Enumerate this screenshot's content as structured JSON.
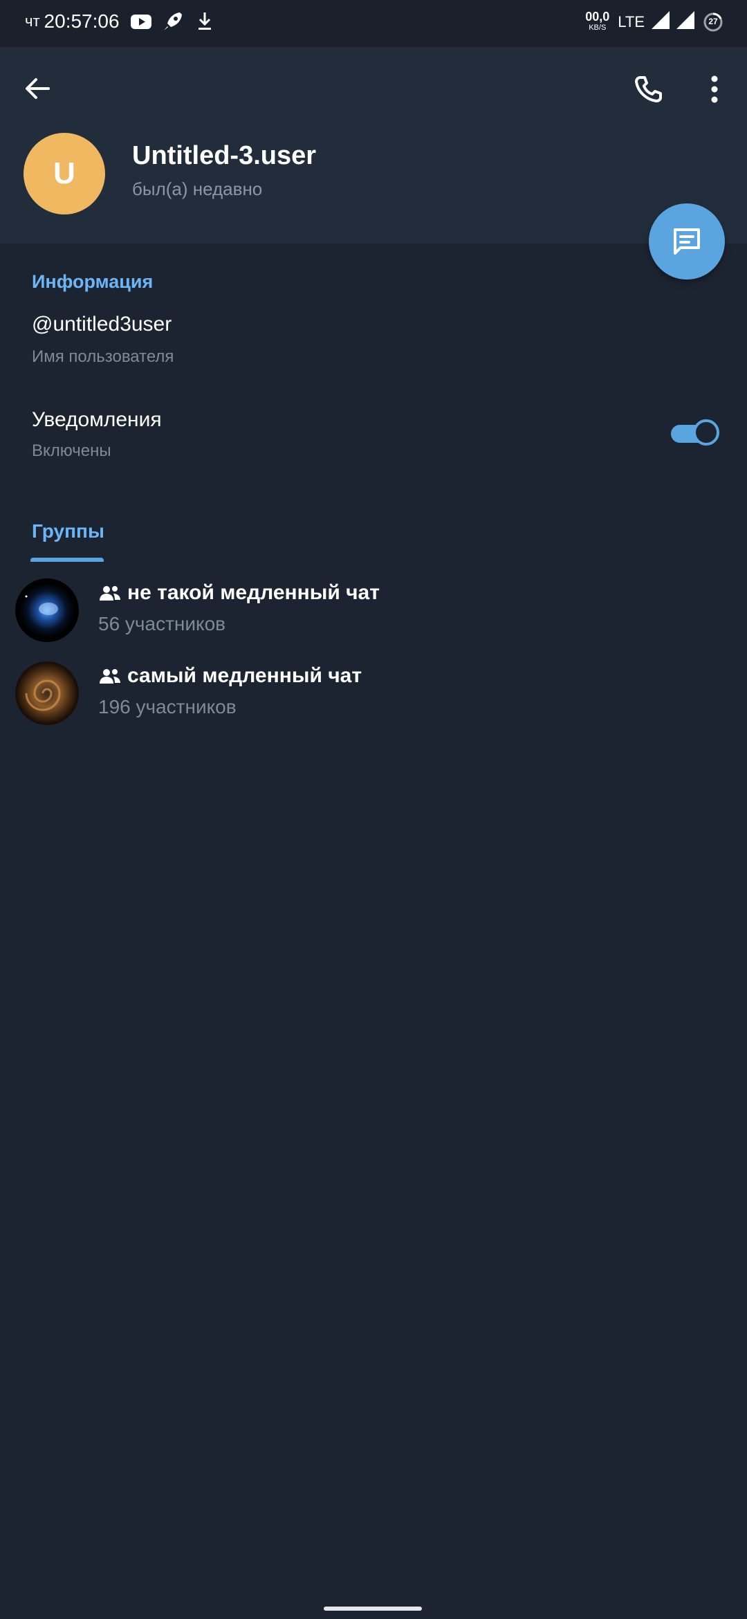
{
  "status_bar": {
    "day": "чт",
    "time": "20:57:06",
    "speed_value": "00,0",
    "speed_unit": "KB/S",
    "network": "LTE",
    "battery": "27"
  },
  "header": {
    "avatar_letter": "U",
    "name": "Untitled-3.user",
    "status": "был(а) недавно"
  },
  "info": {
    "section_title": "Информация",
    "username_value": "@untitled3user",
    "username_label": "Имя пользователя",
    "notifications_title": "Уведомления",
    "notifications_state": "Включены",
    "notifications_enabled": true
  },
  "tabs": {
    "groups_label": "Группы"
  },
  "groups": [
    {
      "title": "не такой медленный чат",
      "members": "56 участников"
    },
    {
      "title": "самый медленный чат",
      "members": "196 участников"
    }
  ],
  "colors": {
    "accent": "#5aa4e0",
    "header_bg": "#222d3c",
    "page_bg": "#1d2431",
    "avatar_bg": "#f0b860"
  },
  "icons": [
    "back-arrow-icon",
    "phone-icon",
    "more-vertical-icon",
    "message-icon",
    "group-icon"
  ]
}
